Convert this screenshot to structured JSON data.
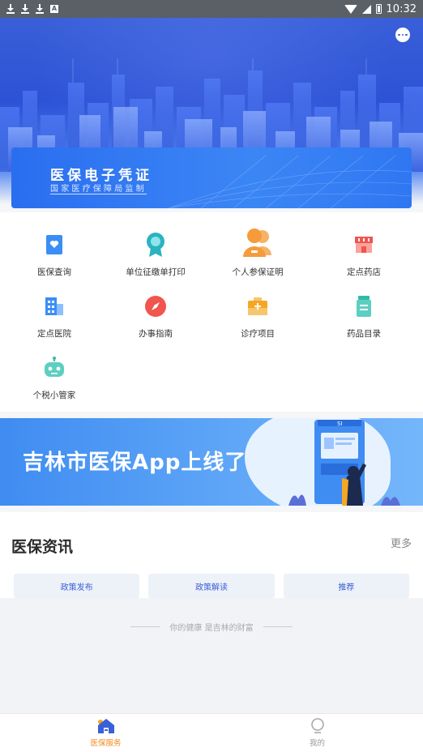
{
  "status_bar": {
    "time": "10:32",
    "notif_letter": "A"
  },
  "hero": {
    "card_title": "医保电子凭证",
    "card_subtitle": "国家医疗保障局监制"
  },
  "services": [
    {
      "label": "医保查询",
      "icon": "heart-card-icon",
      "color": "#3b8ef5"
    },
    {
      "label": "单位征缴单打印",
      "icon": "award-badge-icon",
      "color": "#2bb3c0"
    },
    {
      "label": "个人参保证明",
      "icon": "people-icon",
      "color": "#f59b3a"
    },
    {
      "label": "定点药店",
      "icon": "store-icon",
      "color": "#f0554e"
    },
    {
      "label": "定点医院",
      "icon": "hospital-building-icon",
      "color": "#3b8ef5"
    },
    {
      "label": "办事指南",
      "icon": "compass-icon",
      "color": "#f0554e"
    },
    {
      "label": "诊疗项目",
      "icon": "medical-kit-icon",
      "color": "#f5a623"
    },
    {
      "label": "药品目录",
      "icon": "medicine-bottle-icon",
      "color": "#34b9a8"
    },
    {
      "label": "个税小管家",
      "icon": "robot-icon",
      "color": "#34b9a8"
    }
  ],
  "promo": {
    "text": "吉林市医保App上线了",
    "machine_label": "SI"
  },
  "news": {
    "title": "医保资讯",
    "more": "更多",
    "tabs": [
      "政策发布",
      "政策解读",
      "推荐"
    ],
    "slogan": "你的健康 是吉林的财富"
  },
  "tabbar": [
    {
      "label": "医保服务",
      "icon": "home-service-icon",
      "active": true
    },
    {
      "label": "我的",
      "icon": "profile-icon",
      "active": false
    }
  ],
  "colors": {
    "primary": "#3a5fd8",
    "accent": "#f08a1a"
  }
}
